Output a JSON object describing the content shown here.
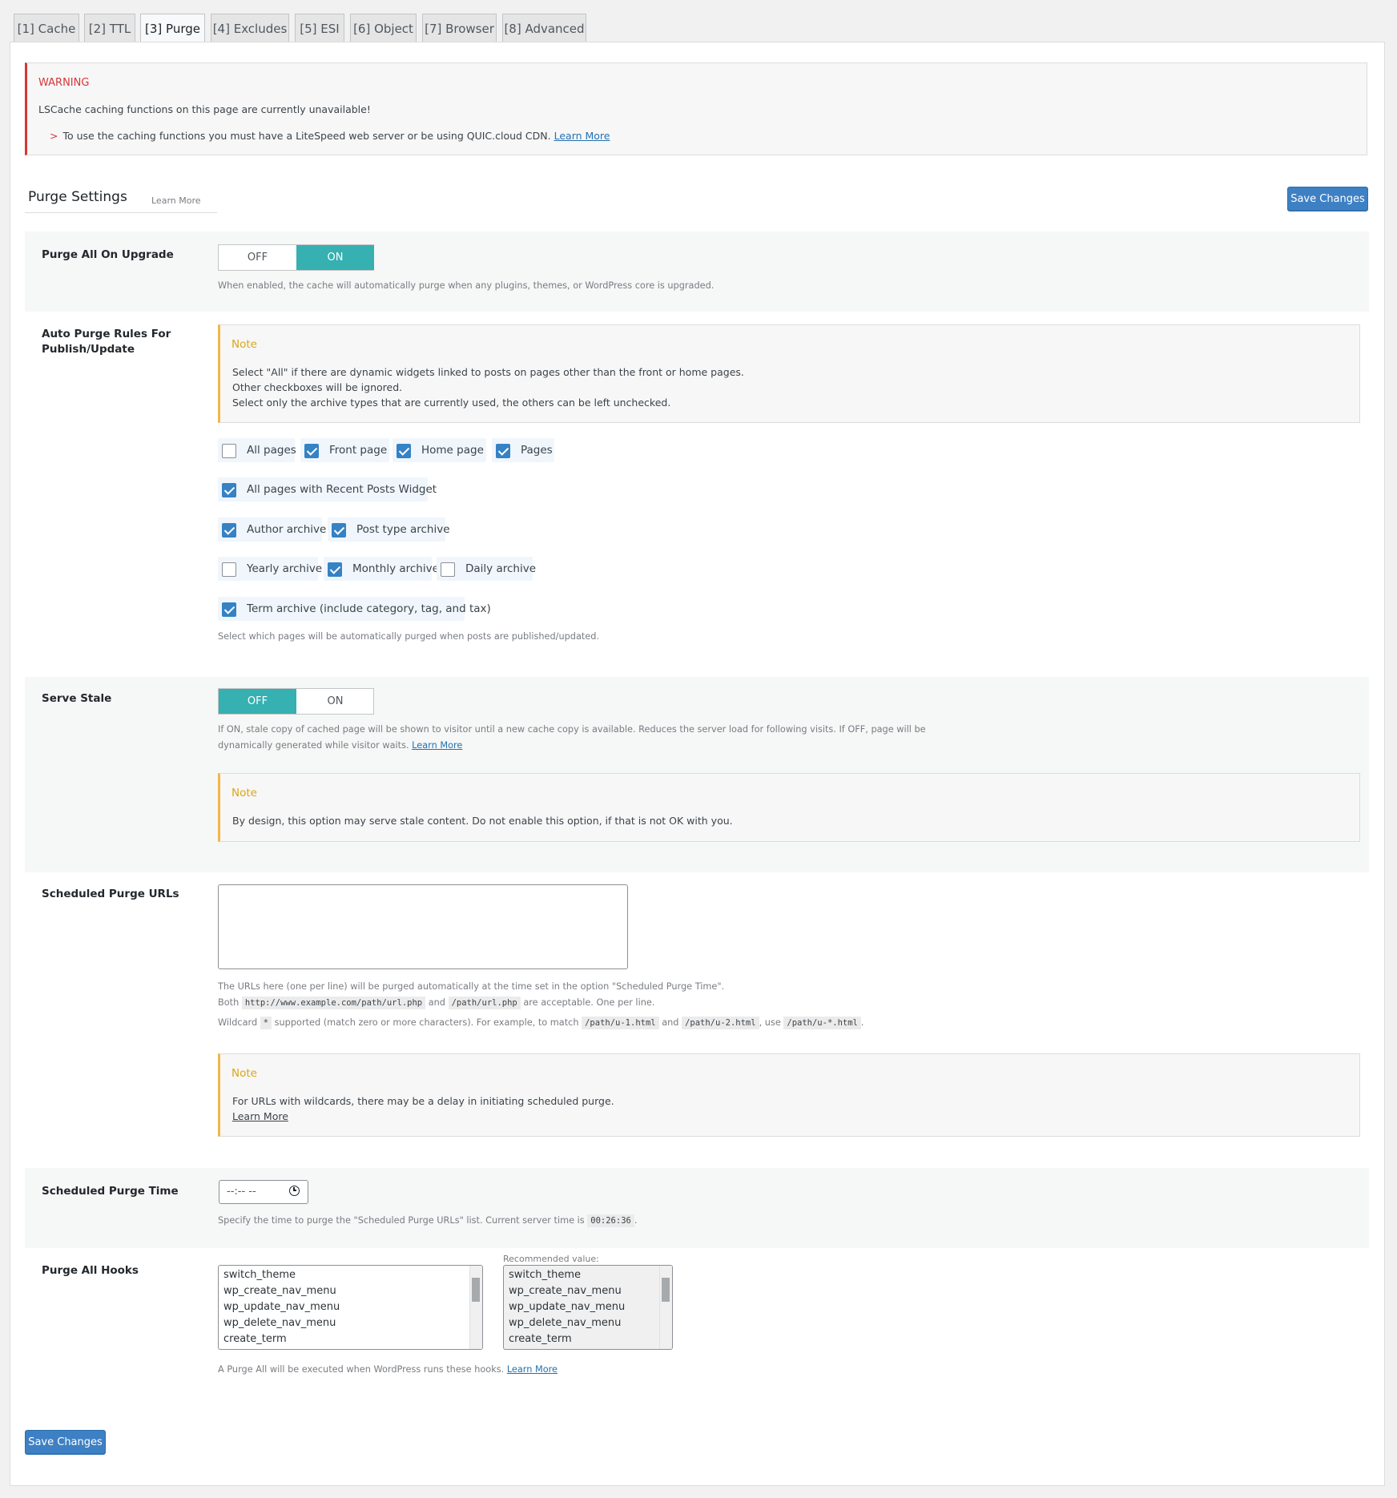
{
  "tabs": [
    "[1] Cache",
    "[2] TTL",
    "[3] Purge",
    "[4] Excludes",
    "[5] ESI",
    "[6] Object",
    "[7] Browser",
    "[8] Advanced"
  ],
  "warning": {
    "title": "WARNING",
    "line1": "LSCache caching functions on this page are currently unavailable!",
    "line2": "To use the caching functions you must have a LiteSpeed web server or be using QUIC.cloud CDN.",
    "learn_more": "Learn More"
  },
  "section": {
    "title": "Purge Settings",
    "learn_more": "Learn More",
    "save": "Save Changes"
  },
  "purge_upgrade": {
    "label": "Purge All On Upgrade",
    "off": "OFF",
    "on": "ON",
    "state": "ON",
    "desc": "When enabled, the cache will automatically purge when any plugins, themes, or WordPress core is upgraded."
  },
  "auto_purge": {
    "label": "Auto Purge Rules For Publish/Update",
    "note_title": "Note",
    "note_lines": [
      "Select \"All\" if there are dynamic widgets linked to posts on pages other than the front or home pages.",
      "Other checkboxes will be ignored.",
      "Select only the archive types that are currently used, the others can be left unchecked."
    ],
    "options": {
      "all_pages": "All pages",
      "front_page": "Front page",
      "home_page": "Home page",
      "pages": "Pages",
      "recent_posts": "All pages with Recent Posts Widget",
      "author_archive": "Author archive",
      "post_type_archive": "Post type archive",
      "yearly_archive": "Yearly archive",
      "monthly_archive": "Monthly archive",
      "daily_archive": "Daily archive",
      "term_archive": "Term archive (include category, tag, and tax)"
    },
    "desc": "Select which pages will be automatically purged when posts are published/updated."
  },
  "serve_stale": {
    "label": "Serve Stale",
    "off": "OFF",
    "on": "ON",
    "state": "OFF",
    "desc1": "If ON, stale copy of cached page will be shown to visitor until a new cache copy is available. Reduces the server load for following visits. If OFF, page will be",
    "desc2": "dynamically generated while visitor waits.",
    "learn_more": "Learn More",
    "note_title": "Note",
    "note_text": "By design, this option may serve stale content. Do not enable this option, if that is not OK with you."
  },
  "scheduled_urls": {
    "label": "Scheduled Purge URLs",
    "value": "",
    "desc1": "The URLs here (one per line) will be purged automatically at the time set in the option \"Scheduled Purge Time\".",
    "desc2_a": "Both",
    "code1": "http://www.example.com/path/url.php",
    "desc2_b": "and",
    "code2": "/path/url.php",
    "desc2_c": "are acceptable. One per line.",
    "desc3_a": "Wildcard",
    "code3": "*",
    "desc3_b": "supported (match zero or more characters). For example, to match",
    "code4": "/path/u-1.html",
    "desc3_c": "and",
    "code5": "/path/u-2.html",
    "desc3_d": ", use",
    "code6": "/path/u-*.html",
    "desc3_e": ".",
    "note_title": "Note",
    "note_text": "For URLs with wildcards, there may be a delay in initiating scheduled purge.",
    "learn_more": "Learn More"
  },
  "scheduled_time": {
    "label": "Scheduled Purge Time",
    "value": "--:-- --",
    "desc_a": "Specify the time to purge the \"Scheduled Purge URLs\" list. Current server time is",
    "server_time": "00:26:36",
    "desc_b": "."
  },
  "purge_hooks": {
    "label": "Purge All Hooks",
    "items": [
      "switch_theme",
      "wp_create_nav_menu",
      "wp_update_nav_menu",
      "wp_delete_nav_menu",
      "create_term"
    ],
    "recommended_label": "Recommended value:",
    "recommended": [
      "switch_theme",
      "wp_create_nav_menu",
      "wp_update_nav_menu",
      "wp_delete_nav_menu",
      "create_term"
    ],
    "desc": "A Purge All will be executed when WordPress runs these hooks.",
    "learn_more": "Learn More"
  },
  "footer": {
    "save": "Save Changes"
  },
  "colors": {
    "accent_teal": "#36b0b0",
    "button_blue": "#3e80c4",
    "warning_red": "#d63638",
    "note_orange": "#f0b849"
  }
}
